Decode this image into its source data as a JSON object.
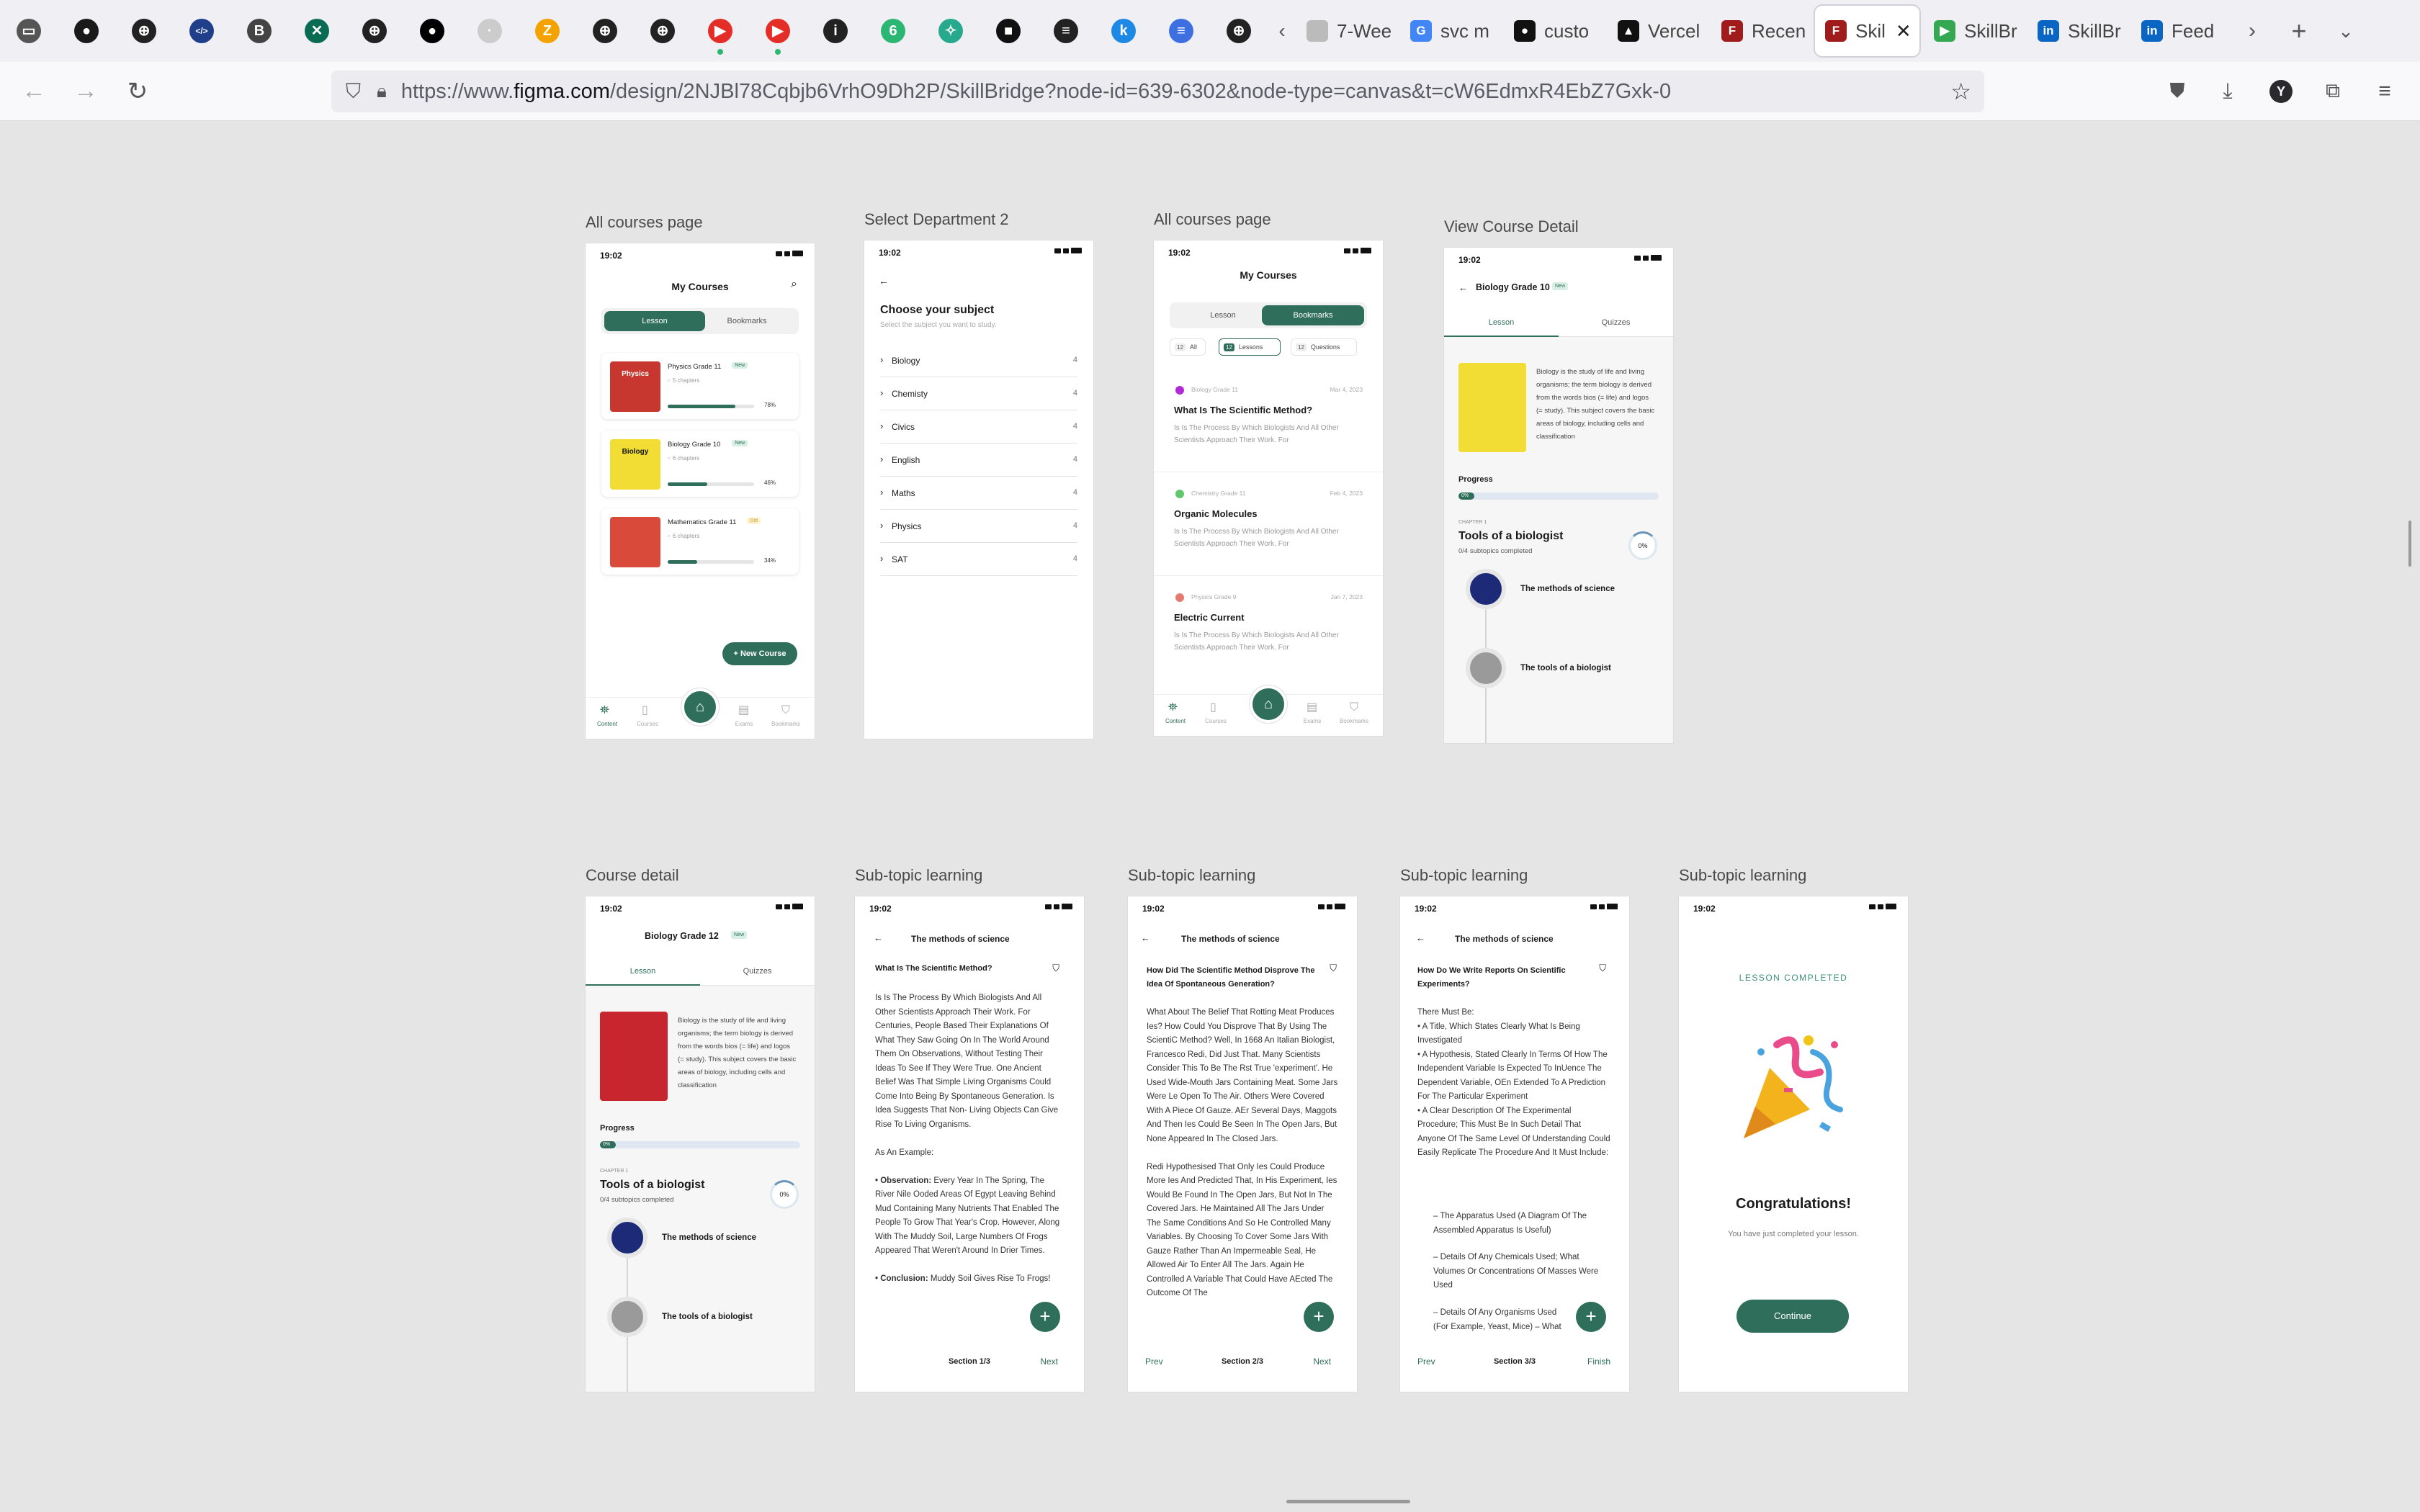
{
  "browser": {
    "favicons": [
      {
        "name": "tab-manager-icon",
        "color": "#555",
        "glyph": "▭"
      },
      {
        "name": "github-icon",
        "color": "#1a1a1a",
        "glyph": "●"
      },
      {
        "name": "globe-icon",
        "color": "#222",
        "glyph": "⊕"
      },
      {
        "name": "code-icon",
        "color": "#1f3f8a",
        "glyph": "</>"
      },
      {
        "name": "bb-icon",
        "color": "#444",
        "glyph": "B"
      },
      {
        "name": "x-icon",
        "color": "#0a6b55",
        "glyph": "✕"
      },
      {
        "name": "globe-icon",
        "color": "#222",
        "glyph": "⊕"
      },
      {
        "name": "circle-icon",
        "color": "#000",
        "glyph": "●"
      },
      {
        "name": "blank-icon",
        "color": "#ccc",
        "glyph": "·"
      },
      {
        "name": "slash-icon",
        "color": "#f3a200",
        "glyph": "Z"
      },
      {
        "name": "globe-icon",
        "color": "#222",
        "glyph": "⊕"
      },
      {
        "name": "globe-icon",
        "color": "#222",
        "glyph": "⊕"
      },
      {
        "name": "youtube-icon",
        "color": "#e52d27",
        "glyph": "▶",
        "playing": true
      },
      {
        "name": "youtube-icon",
        "color": "#e52d27",
        "glyph": "▶",
        "playing": true
      },
      {
        "name": "info-icon",
        "color": "#222",
        "glyph": "i"
      },
      {
        "name": "leaf-icon",
        "color": "#2bb673",
        "glyph": "6"
      },
      {
        "name": "chakra-icon",
        "color": "#27a98e",
        "glyph": "✧"
      },
      {
        "name": "box-icon",
        "color": "#111",
        "glyph": "■"
      },
      {
        "name": "lines-icon",
        "color": "#222",
        "glyph": "≡"
      },
      {
        "name": "k-icon",
        "color": "#1e88e5",
        "glyph": "k"
      },
      {
        "name": "docs-icon",
        "color": "#3d6fe0",
        "glyph": "≡"
      },
      {
        "name": "globe-icon",
        "color": "#222",
        "glyph": "⊕"
      }
    ],
    "tabs": [
      {
        "label": "7-Wee",
        "icon": "blank-icon",
        "color": "#bbb",
        "g": ""
      },
      {
        "label": "svc m",
        "icon": "google-icon",
        "color": "#4285f4",
        "g": "G"
      },
      {
        "label": "custo",
        "icon": "github-icon",
        "color": "#111",
        "g": "●"
      },
      {
        "label": "Vercel",
        "icon": "vercel-icon",
        "color": "#111",
        "g": "▲"
      },
      {
        "label": "Recen",
        "icon": "figma-icon",
        "color": "#a01c1c",
        "g": "F"
      },
      {
        "label": "Skil",
        "icon": "figma-icon",
        "color": "#a01c1c",
        "g": "F",
        "active": true
      },
      {
        "label": "SkillBr",
        "icon": "play-store-icon",
        "color": "#34a853",
        "g": "▶"
      },
      {
        "label": "SkillBr",
        "icon": "linkedin-icon",
        "color": "#0a66c2",
        "g": "in"
      },
      {
        "label": "Feed",
        "icon": "linkedin-icon",
        "color": "#0a66c2",
        "g": "in"
      }
    ],
    "url_prefix": "https://www.",
    "url_domain": "figma.com",
    "url_path": "/design/2NJBl78Cqbjb6VrhO9Dh2P/SkillBridge?node-id=639-6302&node-type=canvas&t=cW6EdmxR4EbZ7Gxk-0"
  },
  "frames": {
    "f1": {
      "label": "All courses page",
      "time": "19:02",
      "title": "My Courses",
      "tab_lesson": "Lesson",
      "tab_bookmarks": "Bookmarks",
      "courses": [
        {
          "title": "Physics Grade 11",
          "badge": "New",
          "chapters": "5 chapters",
          "progress": "78%",
          "p": 0.78,
          "cover": "#c7372f",
          "cover_text": "Physics",
          "badge_bg": "#d8efe5",
          "badge_color": "#2f6e5b"
        },
        {
          "title": "Biology Grade 10",
          "badge": "New",
          "chapters": "6 chapters",
          "progress": "46%",
          "p": 0.46,
          "cover": "#f2dd35",
          "cover_text": "Biology",
          "badge_bg": "#d8efe5",
          "badge_color": "#2f6e5b"
        },
        {
          "title": "Mathematics Grade 11",
          "badge": "Old",
          "chapters": "6 chapters",
          "progress": "34%",
          "p": 0.34,
          "cover": "#d94a3a",
          "cover_text": "",
          "badge_bg": "#fff1cc",
          "badge_color": "#c9a13a"
        }
      ],
      "new_course": "+ New Course",
      "nav": [
        "Content",
        "Courses",
        "",
        "Exams",
        "Bookmarks"
      ]
    },
    "f2": {
      "label": "Select Department 2",
      "time": "19:02",
      "title": "Choose your subject",
      "subtitle": "Select the subject you want to study.",
      "subjects": [
        {
          "name": "Biology",
          "count": "4"
        },
        {
          "name": "Chemisty",
          "count": "4"
        },
        {
          "name": "Civics",
          "count": "4"
        },
        {
          "name": "English",
          "count": "4"
        },
        {
          "name": "Maths",
          "count": "4"
        },
        {
          "name": "Physics",
          "count": "4"
        },
        {
          "name": "SAT",
          "count": "4"
        }
      ]
    },
    "f3": {
      "label": "All courses page",
      "time": "19:02",
      "title": "My Courses",
      "tab_lesson": "Lesson",
      "tab_bookmarks": "Bookmarks",
      "filters": [
        {
          "n": "12",
          "l": "All"
        },
        {
          "n": "12",
          "l": "Lessons"
        },
        {
          "n": "12",
          "l": "Questions"
        }
      ],
      "items": [
        {
          "course": "Biology Grade 11",
          "date": "Mar 4, 2023",
          "title": "What Is The Scientific Method?",
          "text": "Is Is The Process By Which Biologists And All Other Scientists Approach Their Work. For",
          "dot": "#b22ad6"
        },
        {
          "course": "Chemistry Grade 11",
          "date": "Feb 4, 2023",
          "title": "Organic Molecules",
          "text": "Is Is The Process By Which Biologists And All Other Scientists Approach Their Work. For",
          "dot": "#61c76b"
        },
        {
          "course": "Physics Grade 9",
          "date": "Jan 7, 2023",
          "title": "Electric Current",
          "text": "Is Is The Process By Which Biologists And All Other Scientists Approach Their Work. For",
          "dot": "#e47b6e"
        }
      ],
      "nav": [
        "Content",
        "Courses",
        "",
        "Exams",
        "Bookmarks"
      ]
    },
    "f4": {
      "label": "View Course Detail",
      "time": "19:02",
      "course_title": "Biology  Grade 10",
      "badge": "New",
      "tab_lesson": "Lesson",
      "tab_quizzes": "Quizzes",
      "desc": "Biology is the study of life and living organisms; the term biology is derived from the words bios (= life) and logos (= study). This subject covers the basic areas of biology, including cells and classification",
      "progress_label": "Progress",
      "progress_pct": "0%",
      "chapter_label": "CHAPTER 1",
      "chapter_title": "Tools of a biologist",
      "chapter_sub": "0/4 subtopics completed",
      "chapter_pct": "0%",
      "topics": [
        {
          "title": "The methods of science",
          "img": "#1d2a78"
        },
        {
          "title": "The tools of a biologist",
          "img": "#9a9a9a"
        }
      ]
    },
    "f5": {
      "label": "Course detail",
      "time": "19:02",
      "course_title": "Biology  Grade 12",
      "badge": "New",
      "tab_lesson": "Lesson",
      "tab_quizzes": "Quizzes",
      "desc": "Biology is the study of life and living organisms; the term biology is derived from the words bios (= life) and logos (= study). This subject covers the basic areas of biology, including cells and classification",
      "progress_label": "Progress",
      "progress_pct": "0%",
      "chapter_label": "CHAPTER 1",
      "chapter_title": "Tools of a biologist",
      "chapter_sub": "0/4 subtopics completed",
      "chapter_pct": "0%",
      "topics": [
        {
          "title": "The methods of science",
          "img": "#1d2a78"
        },
        {
          "title": "The tools of a biologist",
          "img": "#9a9a9a"
        }
      ]
    },
    "f6": {
      "label": "Sub-topic learning",
      "time": "19:02",
      "title": "The methods of science",
      "question": "What Is The Scientific Method?",
      "p1": "Is Is The Process By Which Biologists And All Other Scientists Approach Their Work. For Centuries, People Based Their Explanations Of What They Saw Going On In The World Around Them On Observations, Without Testing Their Ideas To See If They Were True. One Ancient Belief Was That Simple Living Organisms Could Come Into Being By Spontaneous Generation.  Is Idea Suggests That Non- Living Objects Can Give Rise To Living Organisms.",
      "p2": "As An Example:",
      "obs_label": "• Observation:",
      "obs": " Every Year In The Spring, The River Nile Ooded Areas Of Egypt Leaving Behind Mud Containing Many Nutrients That Enabled The People To Grow That Year's Crop. However, Along With The Muddy Soil, Large Numbers Of Frogs Appeared That Weren't Around In Drier Times.",
      "con_label": "• Conclusion:",
      "con": " Muddy Soil Gives Rise To Frogs!",
      "section": "Section 1/3",
      "next": "Next"
    },
    "f7": {
      "label": "Sub-topic learning",
      "time": "19:02",
      "title": "The methods of science",
      "question": "How Did The Scientific Method Disprove The Idea Of Spontaneous Generation?",
      "p1": "What About The Belief That Rotting Meat Produces Ies? How Could You Disprove That By Using The ScientiC Method? Well, In 1668 An Italian Biologist, Francesco Redi, Did Just That. Many Scientists Consider This To Be The Rst True 'experiment'. He Used Wide-Mouth Jars Containing Meat. Some Jars Were Le Open To The Air. Others Were Covered With A Piece Of Gauze. AEr Several Days, Maggots And Then Ies Could Be Seen In The Open Jars, But None Appeared In The Closed Jars.",
      "p2": "Redi Hypothesised That Only Ies Could Produce More Ies And Predicted That, In His Experiment, Ies Would Be Found In The Open Jars, But Not In The Covered Jars. He Maintained All The Jars Under The Same Conditions And So He Controlled Many Variables. By Choosing To Cover Some Jars With Gauze Rather Than An Impermeable Seal, He Allowed Air To Enter All The Jars. Again He Controlled A Variable That Could Have AEcted The Outcome Of The",
      "prev": "Prev",
      "section": "Section 2/3",
      "next": "Next"
    },
    "f8": {
      "label": "Sub-topic learning",
      "time": "19:02",
      "title": "The methods of science",
      "question": "How Do We Write Reports On Scientific Experiments?",
      "p1": "There Must Be:\n• A Title, Which States Clearly What Is Being Investigated\n• A Hypothesis, Stated Clearly In Terms Of How The Independent Variable Is Expected To InUence The Dependent Variable, OEn Extended To A Prediction For The Particular Experiment\n• A Clear Description Of The Experimental Procedure; This Must Be In Such Detail That Anyone Of The Same Level Of Understanding Could Easily Replicate The Procedure And It Must Include:",
      "l1": "– The Apparatus Used (A Diagram Of The Assembled Apparatus Is Useful)",
      "l2": "– Details Of Any Chemicals Used; What Volumes Or Concentrations Of Masses Were Used",
      "l3": "– Details Of Any Organisms Used (For Example, Yeast, Mice) – What Strain",
      "prev": "Prev",
      "section": "Section 3/3",
      "finish": "Finish"
    },
    "f9": {
      "label": "Sub-topic learning",
      "time": "19:02",
      "completed": "LESSON COMPLETED",
      "congrats": "Congratulations!",
      "sub": "You have just completed your lesson.",
      "continue": "Continue"
    }
  },
  "colors": {
    "primary": "#2f6e5b",
    "canvas": "#e5e5e5"
  }
}
